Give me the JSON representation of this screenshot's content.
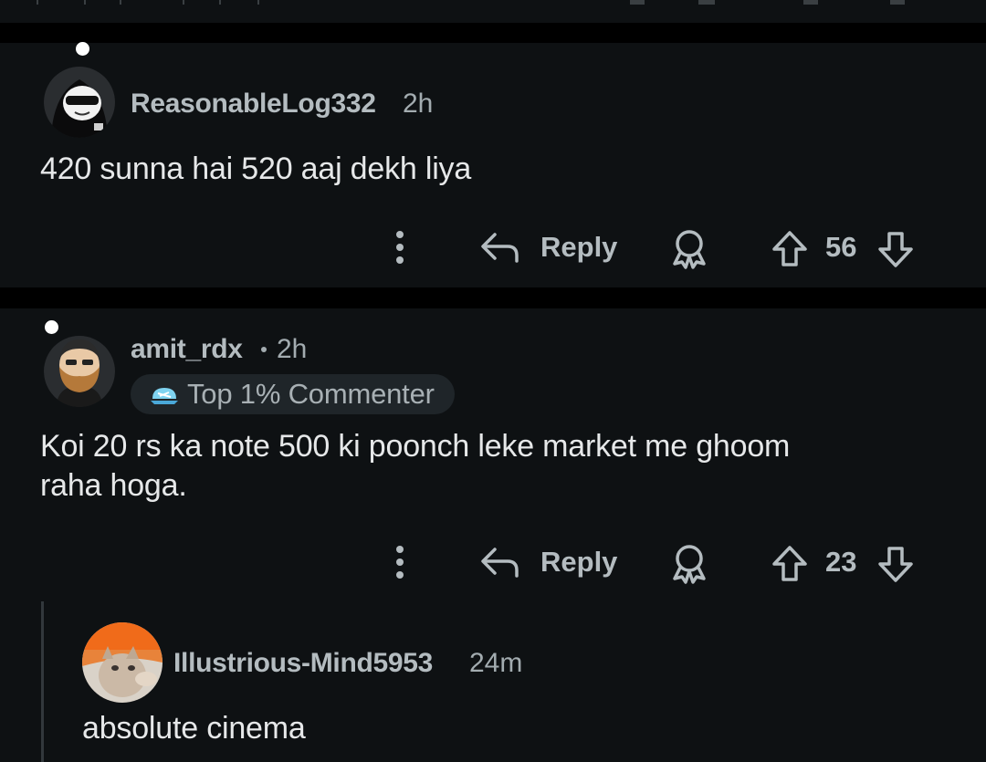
{
  "comments": [
    {
      "username": "ReasonableLog332",
      "time": "2h",
      "body": "420 sunna hai 520 aaj dekh liya",
      "reply_label": "Reply",
      "votes": "56"
    },
    {
      "username": "amit_rdx",
      "time": "2h",
      "flair": "Top 1% Commenter",
      "body_lines": [
        "Koi 20 rs ka note 500 ki poonch leke market me ghoom",
        "raha hoga."
      ],
      "reply_label": "Reply",
      "votes": "23"
    },
    {
      "username": "Illustrious-Mind5953",
      "time": "24m",
      "body": "absolute cinema"
    }
  ],
  "icons": {
    "more": "more-vertical-icon",
    "reply": "reply-arrow-icon",
    "award": "award-icon",
    "upvote": "upvote-icon",
    "downvote": "downvote-icon",
    "flair": "flair-badge-icon"
  },
  "colors": {
    "background": "#000000",
    "panel": "#0e1113",
    "username": "#b4bcc0",
    "body": "#e6e8e9",
    "flair_bg": "#1f2529"
  }
}
